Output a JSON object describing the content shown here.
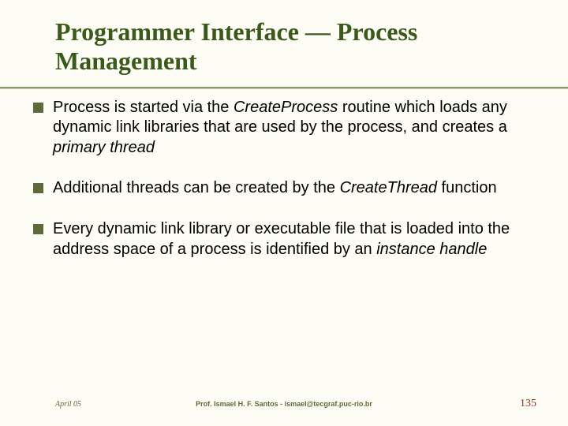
{
  "title": "Programmer Interface — Process Management",
  "bullets": [
    {
      "pre": "Process is started via the ",
      "em1": "CreateProcess",
      "mid1": " routine which loads any dynamic link libraries that are used by the process, and creates a ",
      "em2": "primary thread",
      "post": ""
    },
    {
      "pre": "Additional threads can be created by the ",
      "em1": "CreateThread",
      "mid1": " function",
      "em2": "",
      "post": ""
    },
    {
      "pre": "Every dynamic link library or executable file that is loaded into the address space of a process is identified by an ",
      "em1": "instance handle",
      "mid1": "",
      "em2": "",
      "post": ""
    }
  ],
  "footer": {
    "left": "April 05",
    "center": "Prof. Ismael H. F. Santos - ismael@tecgraf.puc-rio.br",
    "right": "135"
  }
}
